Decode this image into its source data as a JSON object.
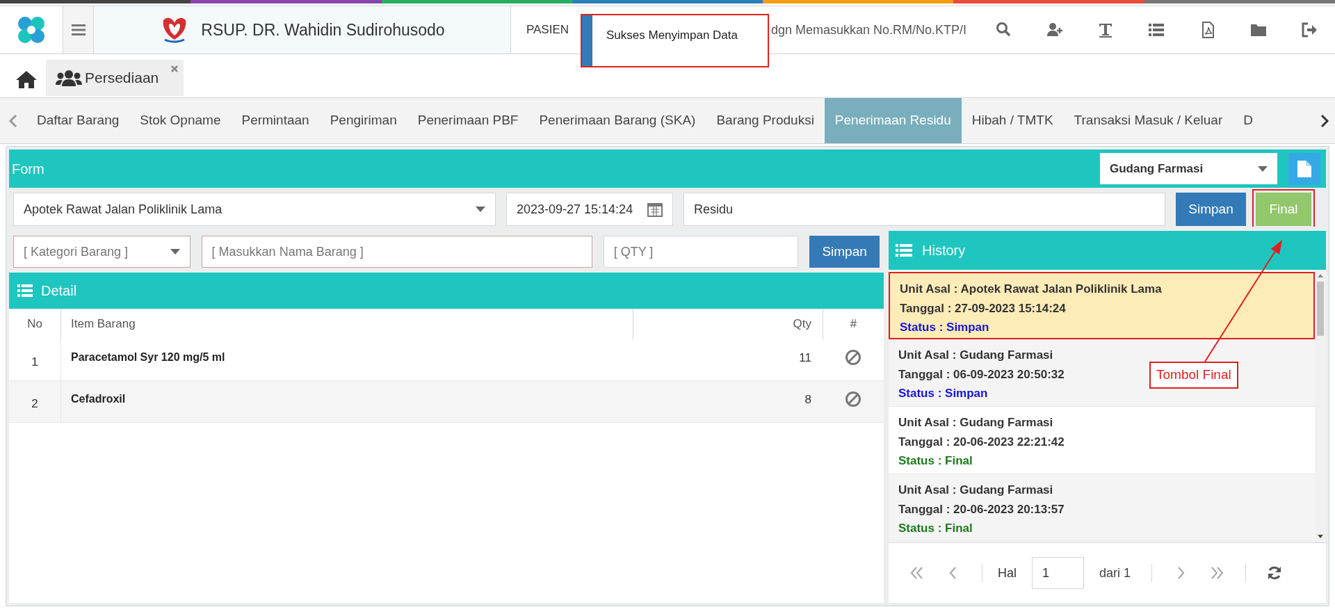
{
  "top_bar": {
    "brand": "RSUP. DR. Wahidin Sudirohusodo",
    "module": "PASIEN",
    "search": {
      "placeholder": "dgn Memasukkan No.RM/No.KTP/I"
    }
  },
  "toast": {
    "message": "Sukses Menyimpan Data",
    "highlighted": true
  },
  "page_tabs": [
    {
      "label": "Persediaan",
      "selected": true
    }
  ],
  "nav_tabs": [
    {
      "label": "Daftar Barang",
      "selected": false
    },
    {
      "label": "Stok Opname",
      "selected": false
    },
    {
      "label": "Permintaan",
      "selected": false
    },
    {
      "label": "Pengiriman",
      "selected": false
    },
    {
      "label": "Penerimaan PBF",
      "selected": false
    },
    {
      "label": "Penerimaan Barang (SKA)",
      "selected": false
    },
    {
      "label": "Barang Produksi",
      "selected": false
    },
    {
      "label": "Penerimaan Residu",
      "selected": true
    },
    {
      "label": "Hibah / TMTK",
      "selected": false
    },
    {
      "label": "Transaksi Masuk / Keluar",
      "selected": false
    },
    {
      "label": "D",
      "selected": false
    }
  ],
  "form": {
    "title": "Form",
    "warehouse": "Gudang Farmasi",
    "unit": "Apotek Rawat Jalan Poliklinik Lama",
    "datetime": "2023-09-27 15:14:24",
    "note": "Residu",
    "buttons": [
      {
        "label": "Simpan",
        "kind": "save",
        "highlighted": false
      },
      {
        "label": "Final",
        "kind": "final",
        "highlighted": true
      }
    ]
  },
  "item_entry": {
    "category_placeholder": "[ Kategori Barang ]",
    "name_placeholder": "[ Masukkan Nama Barang ]",
    "qty_placeholder": "[ QTY ]",
    "button": "Simpan"
  },
  "detail": {
    "title": "Detail",
    "columns": [
      "No",
      "Item Barang",
      "Qty",
      "#"
    ],
    "rows": [
      {
        "no": "1",
        "item": "Paracetamol Syr 120 mg/5 ml",
        "qty": "11"
      },
      {
        "no": "2",
        "item": "Cefadroxil",
        "qty": "8"
      }
    ]
  },
  "history": {
    "title": "History",
    "items": [
      {
        "unit": "Unit Asal : Apotek Rawat Jalan Poliklinik Lama",
        "date": "Tanggal : 27-09-2023 15:14:24",
        "status": "Status : Simpan",
        "kind": "saved",
        "selected": true,
        "highlighted": true
      },
      {
        "unit": "Unit Asal : Gudang Farmasi",
        "date": "Tanggal : 06-09-2023 20:50:32",
        "status": "Status : Simpan",
        "kind": "saved",
        "selected": false,
        "highlighted": false
      },
      {
        "unit": "Unit Asal : Gudang Farmasi",
        "date": "Tanggal : 20-06-2023 22:21:42",
        "status": "Status : Final",
        "kind": "final",
        "selected": false,
        "highlighted": false
      },
      {
        "unit": "Unit Asal : Gudang Farmasi",
        "date": "Tanggal : 20-06-2023 20:13:57",
        "status": "Status : Final",
        "kind": "final",
        "selected": false,
        "highlighted": false
      }
    ],
    "pager": {
      "label": "Hal",
      "page": "1",
      "total": "dari 1"
    }
  },
  "annotation": {
    "label": "Tombol Final"
  }
}
